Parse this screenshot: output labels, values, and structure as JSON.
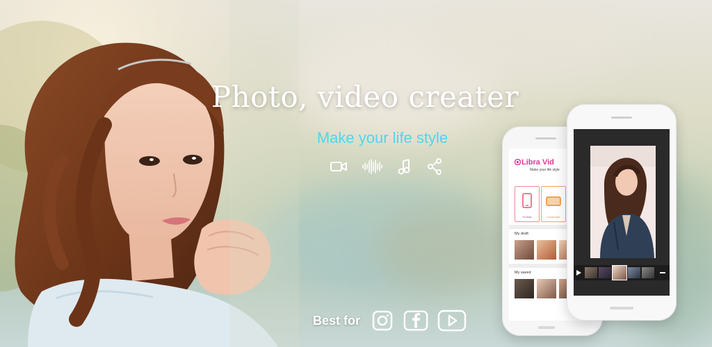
{
  "banner": {
    "title": "Photo, video creater",
    "subtitle": "Make your life style",
    "best_for_label": "Best for"
  },
  "feature_icons": [
    "video-camera-icon",
    "audio-waveform-icon",
    "music-note-icon",
    "share-icon"
  ],
  "social_icons": [
    "instagram-icon",
    "facebook-icon",
    "youtube-icon"
  ],
  "phone_back": {
    "app_name": "Libra Vid",
    "app_tagline": "Make your life style",
    "modes": [
      {
        "label": "Portrait"
      },
      {
        "label": "Landscape"
      }
    ],
    "my_draft_label": "My draft",
    "my_saved_label": "My saved"
  },
  "colors": {
    "subtitle": "#4fd6ec",
    "brand_pink": "#cc3f97",
    "white": "#ffffff"
  }
}
